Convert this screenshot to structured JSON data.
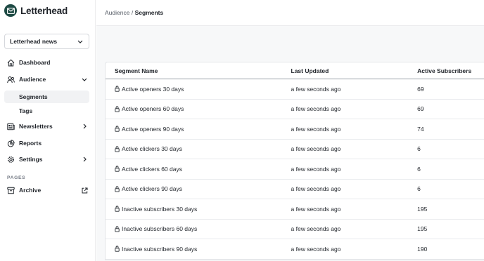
{
  "app": {
    "name": "Letterhead"
  },
  "sidebar": {
    "publication": "Letterhead news",
    "items": [
      {
        "label": "Dashboard",
        "icon": "home-icon"
      },
      {
        "label": "Audience",
        "icon": "users-icon"
      },
      {
        "label": "Newsletters",
        "icon": "newspaper-icon"
      },
      {
        "label": "Reports",
        "icon": "chart-pie-icon"
      },
      {
        "label": "Settings",
        "icon": "gear-icon"
      }
    ],
    "audience_sub": [
      {
        "label": "Segments",
        "active": true
      },
      {
        "label": "Tags",
        "active": false
      }
    ],
    "pages_label": "PAGES",
    "archive": {
      "label": "Archive",
      "icon": "archive-box-icon"
    }
  },
  "breadcrumb": {
    "parent": "Audience",
    "separator": "/",
    "current": "Segments"
  },
  "table": {
    "headers": [
      "Segment Name",
      "Last Updated",
      "Active Subscribers"
    ],
    "rows": [
      {
        "name": "Active openers 30 days",
        "updated": "a few seconds ago",
        "count": "69"
      },
      {
        "name": "Active openers 60 days",
        "updated": "a few seconds ago",
        "count": "69"
      },
      {
        "name": "Active openers 90 days",
        "updated": "a few seconds ago",
        "count": "74"
      },
      {
        "name": "Active clickers 30 days",
        "updated": "a few seconds ago",
        "count": "6"
      },
      {
        "name": "Active clickers 60 days",
        "updated": "a few seconds ago",
        "count": "6"
      },
      {
        "name": "Active clickers 90 days",
        "updated": "a few seconds ago",
        "count": "6"
      },
      {
        "name": "Inactive subscribers 30 days",
        "updated": "a few seconds ago",
        "count": "195"
      },
      {
        "name": "Inactive subscribers 60 days",
        "updated": "a few seconds ago",
        "count": "195"
      },
      {
        "name": "Inactive subscribers 90 days",
        "updated": "a few seconds ago",
        "count": "190"
      }
    ]
  },
  "colors": {
    "brand": "#1f4b45",
    "active_bg": "#f1f2f4",
    "text": "#1f2329"
  }
}
